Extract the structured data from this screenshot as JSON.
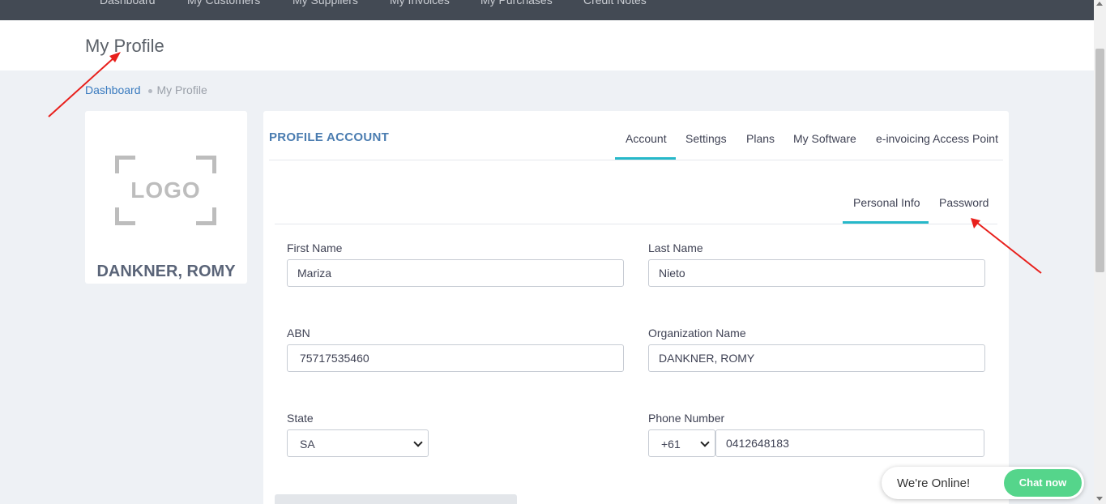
{
  "nav": {
    "items": [
      "Dashboard",
      "My Customers",
      "My Suppliers",
      "My Invoices",
      "My Purchases",
      "Credit Notes"
    ]
  },
  "page": {
    "title": "My Profile"
  },
  "breadcrumb": {
    "home": "Dashboard",
    "current": "My Profile"
  },
  "logo_card": {
    "logo_text": "LOGO",
    "company_name": "DANKNER, ROMY"
  },
  "profile": {
    "card_title": "PROFILE ACCOUNT",
    "tabs": [
      "Account",
      "Settings",
      "Plans",
      "My Software",
      "e-invoicing Access Point"
    ],
    "active_tab": "Account",
    "subtabs": [
      "Personal Info",
      "Password"
    ],
    "active_subtab": "Personal Info"
  },
  "form": {
    "first_name": {
      "label": "First Name",
      "value": "Mariza"
    },
    "last_name": {
      "label": "Last Name",
      "value": "Nieto"
    },
    "abn": {
      "label": "ABN",
      "value": "75717535460"
    },
    "organization": {
      "label": "Organization Name",
      "value": "DANKNER, ROMY"
    },
    "state": {
      "label": "State",
      "value": "SA"
    },
    "phone": {
      "label": "Phone Number",
      "country_code": "+61",
      "value": "0412648183"
    }
  },
  "chat": {
    "status": "We're Online!",
    "button": "Chat now"
  },
  "colors": {
    "accent": "#26b8c9",
    "nav_bg": "#434a54",
    "chat_green": "#55d58b",
    "link": "#3a7bbf",
    "arrow": "#e8201c"
  }
}
